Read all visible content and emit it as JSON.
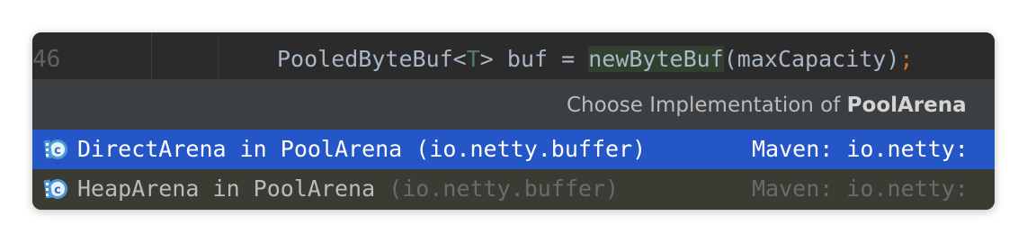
{
  "editor": {
    "line_number": "46",
    "code": {
      "type_name": "PooledByteBuf",
      "open_generic": "<",
      "generic_param": "T",
      "close_generic": ">",
      "variable": " buf = ",
      "call_name": "newByteBuf",
      "args": "(maxCapacity)",
      "semicolon": ";"
    }
  },
  "popup": {
    "title_prefix": "Choose Implementation of ",
    "title_bold": "PoolArena",
    "items": [
      {
        "name": "DirectArena in PoolArena",
        "package": " (io.netty.buffer)",
        "source": "Maven: io.netty:",
        "selected": true,
        "icon": "class-icon"
      },
      {
        "name": "HeapArena in PoolArena",
        "package": " (io.netty.buffer)",
        "source": "Maven: io.netty:",
        "selected": false,
        "icon": "class-icon"
      }
    ]
  },
  "colors": {
    "selection": "#2456c7",
    "popup_bg": "#3c3f41",
    "editor_bg": "#2b2b2b",
    "icon_blue": "#4d9ad9"
  }
}
